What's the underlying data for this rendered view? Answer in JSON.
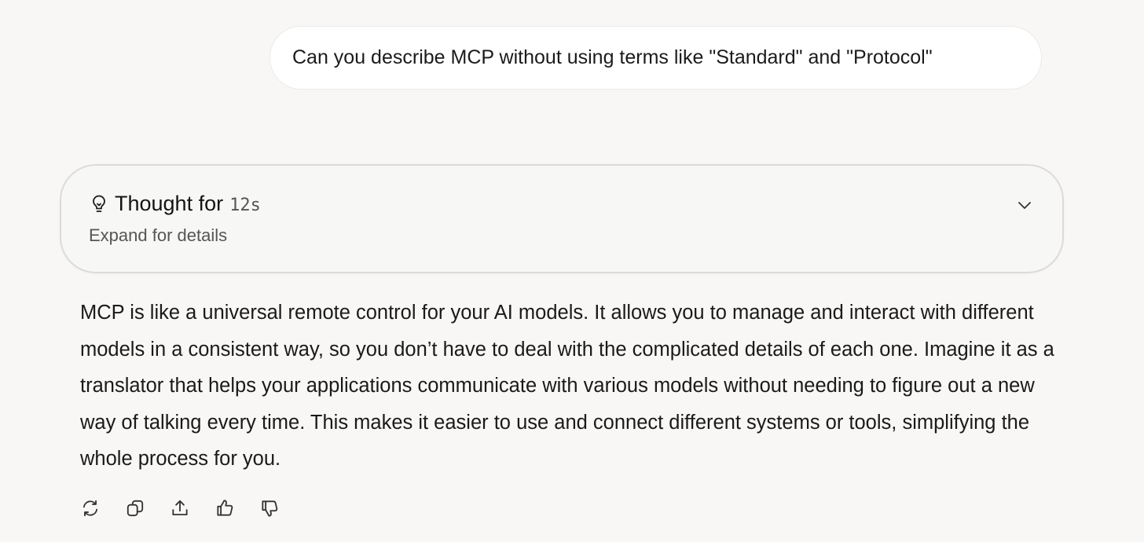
{
  "user_message": {
    "text": "Can you describe MCP without using terms like \"Standard\" and \"Protocol\""
  },
  "thought": {
    "label": "Thought for",
    "duration": "12s",
    "subtitle": "Expand for details",
    "icon": "lightbulb-icon",
    "toggle_icon": "chevron-down-icon"
  },
  "answer": {
    "text": "MCP is like a universal remote control for your AI models. It allows you to manage and interact with different models in a consistent way, so you don’t have to deal with the complicated details of each one. Imagine it as a translator that helps your applications communicate with various models without needing to figure out a new way of talking every time. This makes it easier to use and connect different systems or tools, simplifying the whole process for you."
  },
  "actions": [
    {
      "name": "regenerate",
      "icon": "refresh-icon"
    },
    {
      "name": "copy",
      "icon": "copy-icon"
    },
    {
      "name": "share",
      "icon": "share-icon"
    },
    {
      "name": "like",
      "icon": "thumbs-up-icon"
    },
    {
      "name": "dislike",
      "icon": "thumbs-down-icon"
    }
  ],
  "colors": {
    "background": "#f8f7f5",
    "bubble": "#ffffff",
    "border": "#dcdbd8",
    "text": "#1a1a1a",
    "muted": "#555555"
  }
}
